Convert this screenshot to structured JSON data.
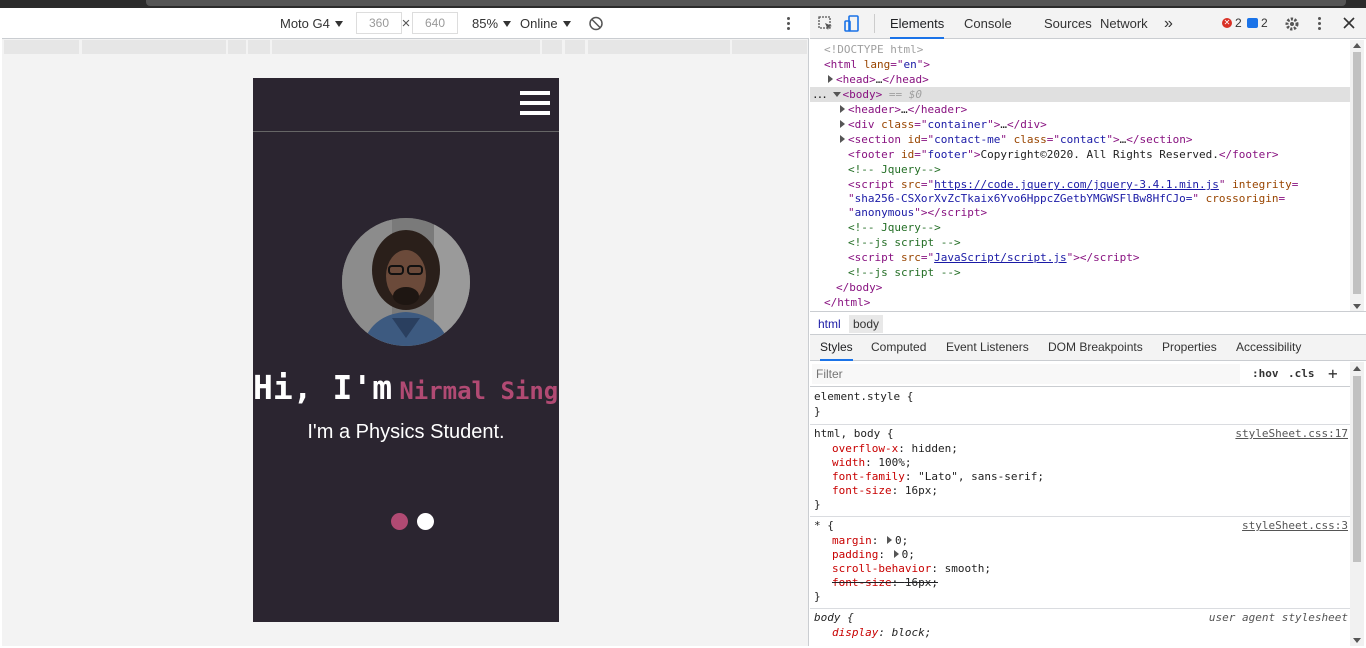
{
  "device_toolbar": {
    "device": "Moto G4",
    "width": "360",
    "height": "640",
    "dim_sep": "×",
    "zoom": "85%",
    "throttle": "Online"
  },
  "page": {
    "greeting": "Hi, I'm",
    "name": "Nirmal Singh",
    "subtitle": "I'm a Physics Student.",
    "colors": {
      "background": "#2b2530",
      "accent": "#b14a73"
    }
  },
  "devtools": {
    "tabs": [
      "Elements",
      "Console",
      "Sources",
      "Network"
    ],
    "more": "»",
    "error_count": "2",
    "message_count": "2",
    "dom": {
      "doctype": "<!DOCTYPE html>",
      "html_open_tag": "html",
      "html_attr_name": "lang",
      "html_attr_value": "en",
      "head": "head",
      "head_ellipsis": "…",
      "body": "body",
      "body_marker": "== $0",
      "row_dots": "...",
      "header": "header",
      "div": "div",
      "div_attr_name": "class",
      "div_attr_value": "container",
      "section": "section",
      "section_id_name": "id",
      "section_id_value": "contact-me",
      "section_class_name": "class",
      "section_class_value": "contact",
      "footer": "footer",
      "footer_id_name": "id",
      "footer_id_value": "footer",
      "footer_text": "Copyright©2020. All Rights Reserved.",
      "comment_jquery": "<!--       Jquery-->",
      "script": "script",
      "script_src_name": "src",
      "script_jquery_src": "https://code.jquery.com/jquery-3.4.1.min.js",
      "integrity_name": "integrity",
      "integrity_value": "sha256-CSXorXvZcTkaix6Yvo6HppcZGetbYMGWSFlBw8HfCJo=",
      "crossorigin_name": "crossorigin",
      "crossorigin_value": "anonymous",
      "comment_jquery2": "<!--       Jquery-->",
      "comment_js1": "<!--js script       -->",
      "script_js_src": "JavaScript/script.js",
      "comment_js2": "<!--js script       -->",
      "body_close": "/body",
      "html_close": "/html"
    },
    "breadcrumbs": [
      "html",
      "body"
    ],
    "sub_tabs": [
      "Styles",
      "Computed",
      "Event Listeners",
      "DOM Breakpoints",
      "Properties",
      "Accessibility"
    ],
    "filter_placeholder": "Filter",
    "filter_tools": {
      "hov": ":hov",
      "cls": ".cls",
      "plus": "+"
    },
    "styles": {
      "element_style": "element.style {",
      "close": "}",
      "rule1": {
        "selector": "html, body {",
        "source": "styleSheet.css:17",
        "decls": [
          {
            "name": "overflow-x",
            "value": "hidden;"
          },
          {
            "name": "width",
            "value": "100%;"
          },
          {
            "name": "font-family",
            "value": "\"Lato\", sans-serif;"
          },
          {
            "name": "font-size",
            "value": "16px;"
          }
        ]
      },
      "rule2": {
        "selector": "* {",
        "source": "styleSheet.css:3",
        "decls": [
          {
            "name": "margin",
            "value": "0;"
          },
          {
            "name": "padding",
            "value": "0;"
          },
          {
            "name": "scroll-behavior",
            "value": "smooth;"
          },
          {
            "name": "font-size",
            "value": "16px;"
          }
        ]
      },
      "rule3": {
        "selector": "body {",
        "source": "user agent stylesheet",
        "decls": [
          {
            "name": "display",
            "value": "block;"
          }
        ]
      }
    }
  }
}
